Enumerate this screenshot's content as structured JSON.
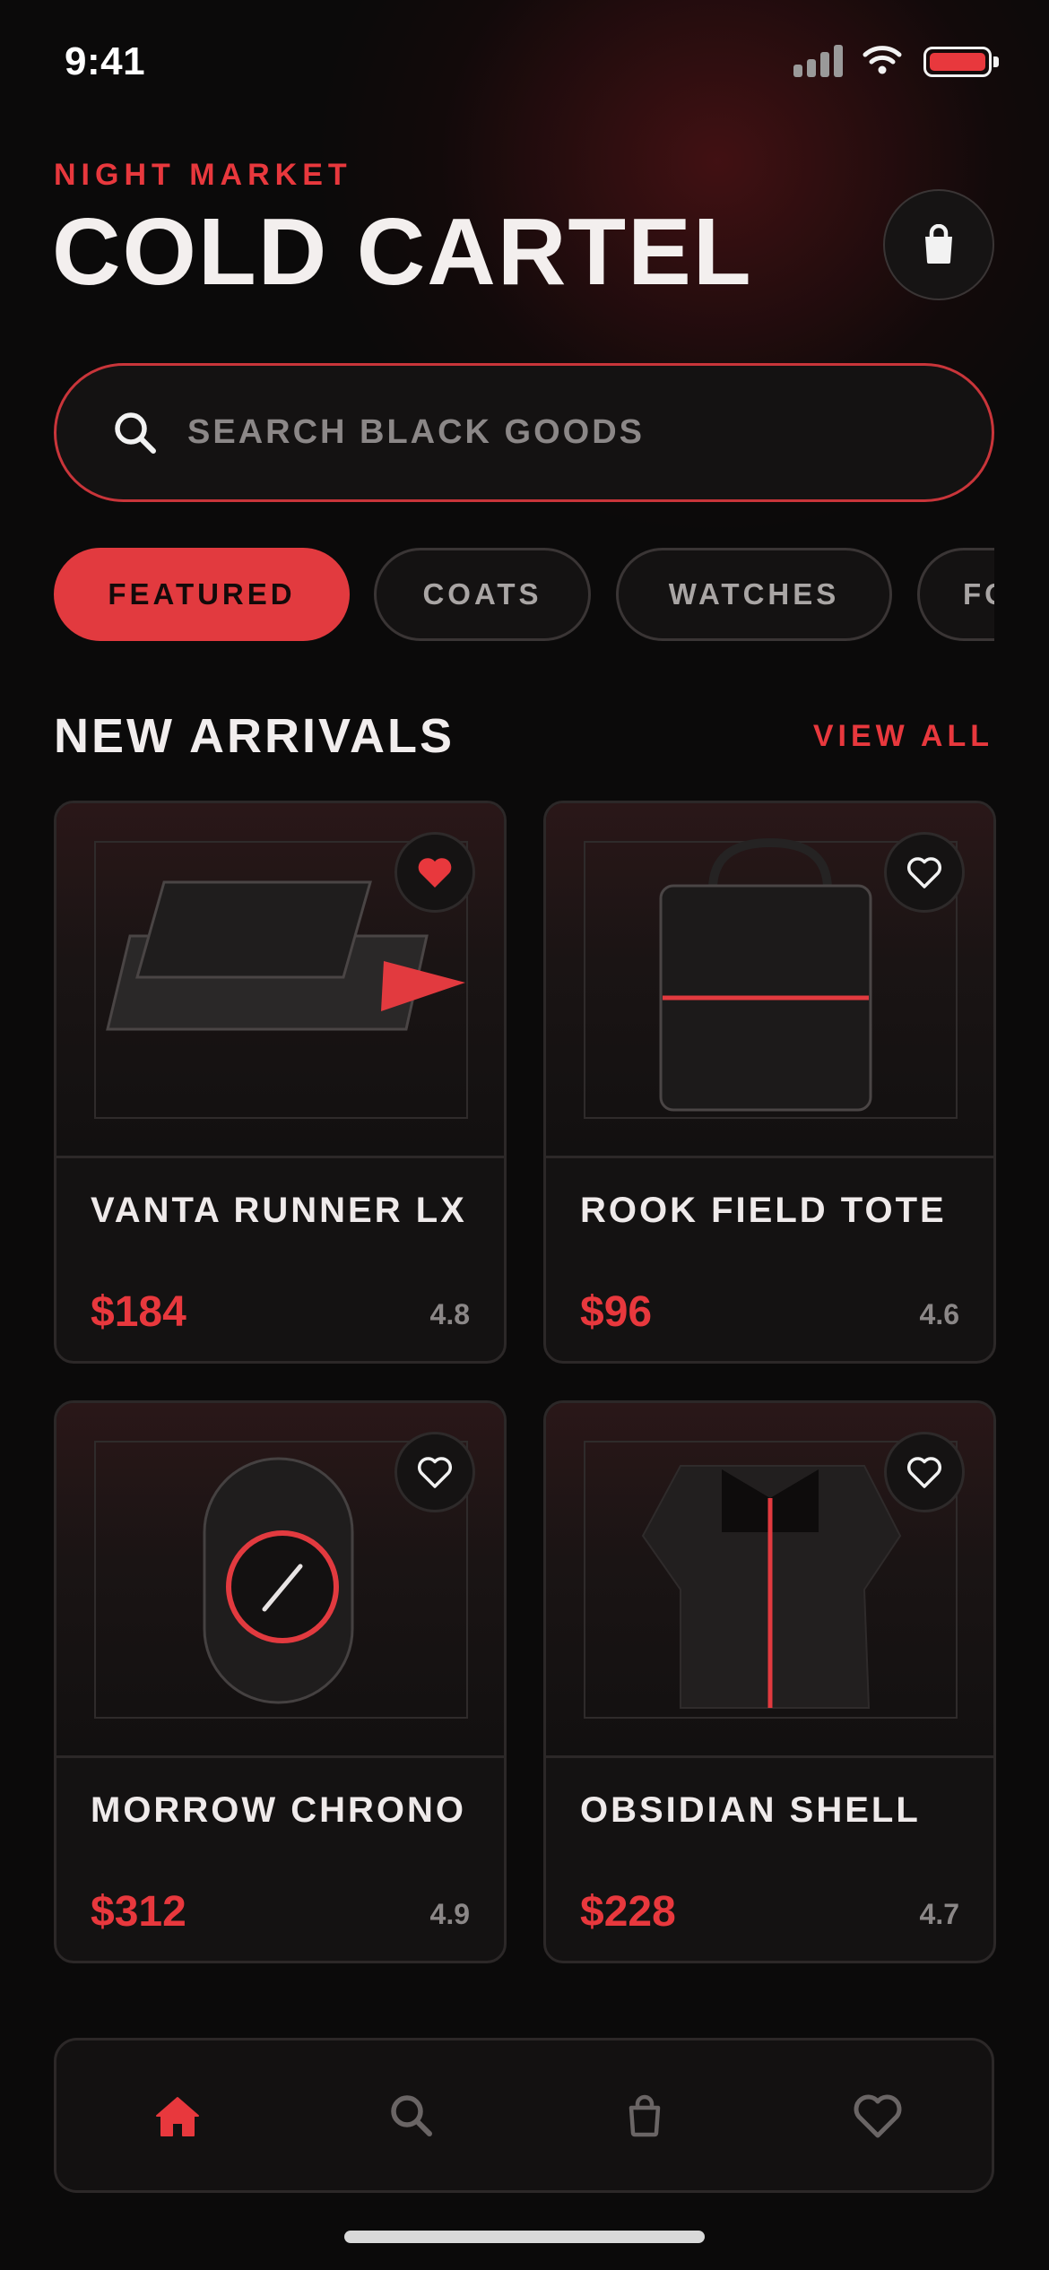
{
  "status_bar": {
    "time": "9:41"
  },
  "header": {
    "kicker": "NIGHT MARKET",
    "title": "COLD CARTEL",
    "cart_icon": "shopping-bag-icon"
  },
  "search": {
    "placeholder": "SEARCH BLACK GOODS",
    "icon": "search-icon"
  },
  "categories": [
    {
      "label": "FEATURED",
      "active": true
    },
    {
      "label": "COATS",
      "active": false
    },
    {
      "label": "WATCHES",
      "active": false
    },
    {
      "label": "FOOTWEAR",
      "active": false
    }
  ],
  "section": {
    "title": "NEW ARRIVALS",
    "view_all": "VIEW ALL"
  },
  "products": [
    {
      "name": "VANTA RUNNER LX",
      "price": "$184",
      "rating": "4.8",
      "favorited": true
    },
    {
      "name": "ROOK FIELD TOTE",
      "price": "$96",
      "rating": "4.6",
      "favorited": false
    },
    {
      "name": "MORROW CHRONO",
      "price": "$312",
      "rating": "4.9",
      "favorited": false
    },
    {
      "name": "OBSIDIAN SHELL",
      "price": "$228",
      "rating": "4.7",
      "favorited": false
    }
  ],
  "tab_bar": {
    "items": [
      {
        "icon": "home-icon",
        "active": true
      },
      {
        "icon": "search-icon",
        "active": false
      },
      {
        "icon": "shopping-bag-icon",
        "active": false
      },
      {
        "icon": "heart-icon",
        "active": false
      }
    ]
  },
  "colors": {
    "accent": "#e8383d",
    "background": "#0b0a0a",
    "surface": "#141212",
    "text": "#f1eded",
    "muted": "#8b8787"
  }
}
